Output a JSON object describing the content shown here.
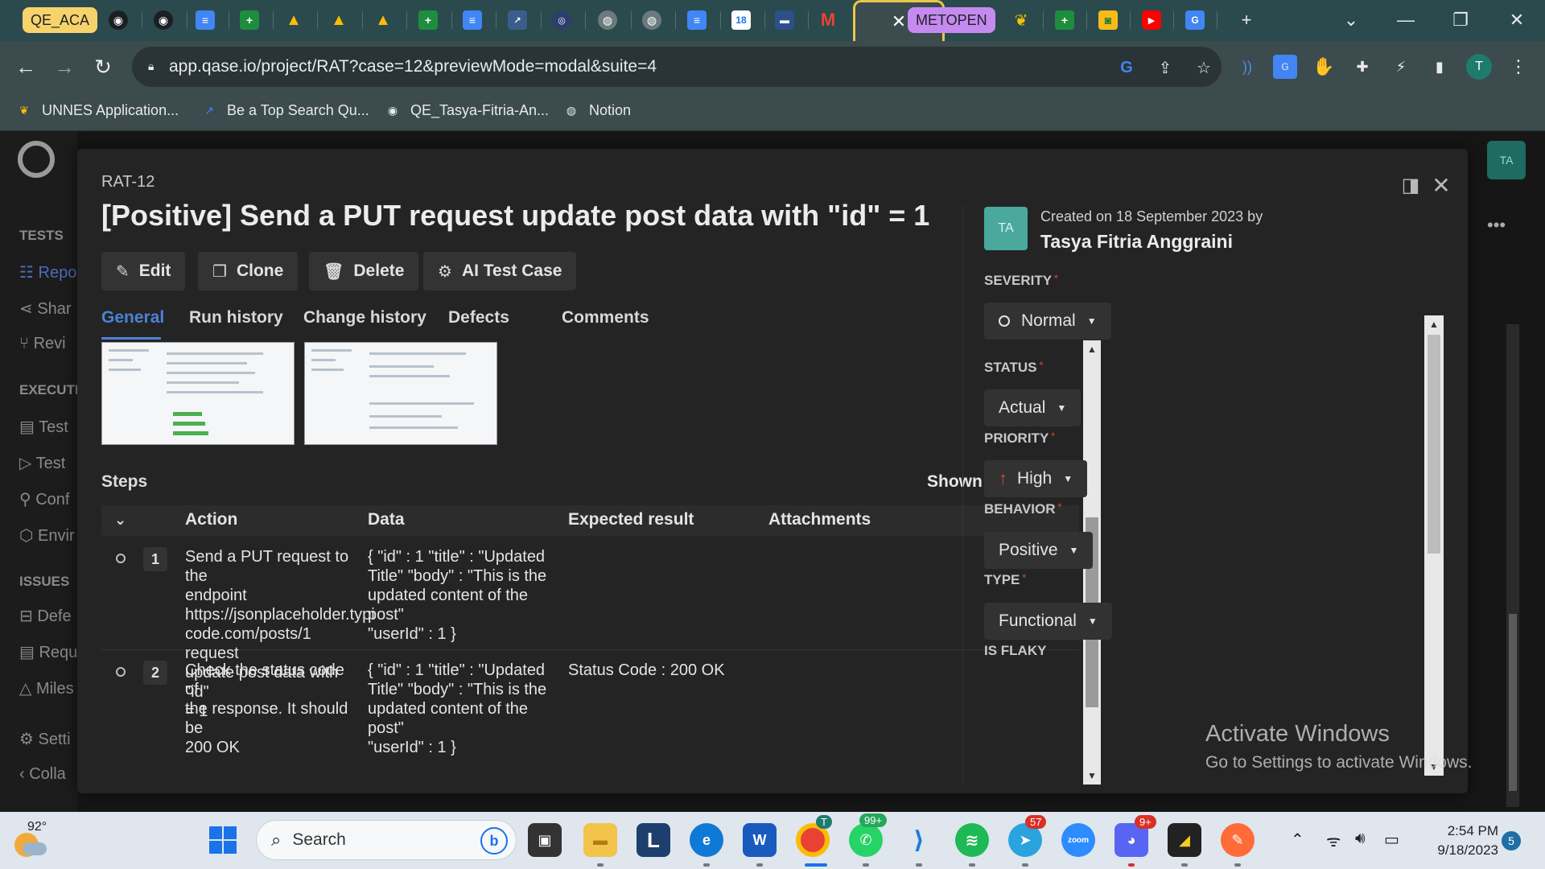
{
  "browser": {
    "tab_groups": [
      {
        "label": "QE_ACA",
        "color": "#f7d36b"
      },
      {
        "label": "METOPEN",
        "color": "#c58af0"
      }
    ],
    "active_tab_close": "✕",
    "new_tab": "+",
    "window_controls": {
      "dropdown": "⌄",
      "minimize": "—",
      "restore": "❐",
      "close": "✕"
    },
    "address": "app.qase.io/project/RAT?case=12&previewMode=modal&suite=4",
    "profile_initial": "T",
    "bookmarks": [
      "UNNES Application...",
      "Be a Top Search Qu...",
      "QE_Tasya-Fitria-An...",
      "Notion"
    ]
  },
  "app": {
    "sidebar": {
      "section_tests": "TESTS",
      "items_tests": [
        "Repo",
        "Shar",
        "Revi"
      ],
      "section_execution": "EXECUTI",
      "items_execution": [
        "Test",
        "Test",
        "Conf",
        "Envir"
      ],
      "section_issues": "ISSUES",
      "items_issues": [
        "Defe",
        "Requ",
        "Miles"
      ],
      "items_bottom": [
        "Setti",
        "Colla"
      ]
    },
    "top_right_avatar": "TA",
    "more": "•••",
    "notification_count": "5"
  },
  "modal": {
    "case_id": "RAT-12",
    "title": "[Positive] Send a PUT request update post data with \"id\" = 1",
    "actions": [
      "Edit",
      "Clone",
      "Delete",
      "AI Test Case"
    ],
    "tabs": [
      "General",
      "Run history",
      "Change history",
      "Defects",
      "Comments"
    ],
    "active_tab": "General",
    "steps_label": "Steps",
    "shown_as_table": "Shown as table",
    "toggle_on": true,
    "columns": [
      "Action",
      "Data",
      "Expected result",
      "Attachments"
    ],
    "steps": [
      {
        "num": "1",
        "action": "Send a PUT request to the endpoint https://jsonplaceholder.typicode.com/posts/1 request update post data with \"id\" = 1",
        "action_lines": [
          "Send a PUT request to the",
          "endpoint",
          "https://jsonplaceholder.typi",
          "code.com/posts/1 request",
          "update post data with \"id\"",
          "= 1"
        ],
        "data_lines": [
          "{ \"id\" : 1 \"title\" : \"Updated",
          "Title\" \"body\" : \"This is the",
          "updated content of the post\"",
          "\"userId\" : 1 }"
        ],
        "expected": ""
      },
      {
        "num": "2",
        "action": "Check the status code of the response. It should be 200 OK",
        "action_lines": [
          "Check the status code of",
          "the response. It should be",
          "200 OK"
        ],
        "data_lines": [
          "{ \"id\" : 1 \"title\" : \"Updated",
          "Title\" \"body\" : \"This is the",
          "updated content of the post\"",
          "\"userId\" : 1 }"
        ],
        "expected": "Status Code : 200 OK"
      }
    ],
    "panel": {
      "author_initials": "TA",
      "created": "Created on 18 September 2023 by",
      "author": "Tasya Fitria Anggraini",
      "fields": [
        {
          "label": "SEVERITY",
          "value": "Normal"
        },
        {
          "label": "STATUS",
          "value": "Actual"
        },
        {
          "label": "PRIORITY",
          "value": "High"
        },
        {
          "label": "BEHAVIOR",
          "value": "Positive"
        },
        {
          "label": "TYPE",
          "value": "Functional"
        },
        {
          "label": "IS FLAKY",
          "value": ""
        }
      ],
      "required_mark": "*"
    }
  },
  "watermark": {
    "line1": "Activate Windows",
    "line2": "Go to Settings to activate Windows."
  },
  "taskbar": {
    "weather": "92°",
    "search": "Search",
    "badges": {
      "whatsapp": "99+",
      "telegram": "57",
      "discord": "9+",
      "chrome_profile": "T"
    },
    "zoom_label": "zoom",
    "time": "2:54 PM",
    "date": "9/18/2023",
    "notifications": "5"
  }
}
